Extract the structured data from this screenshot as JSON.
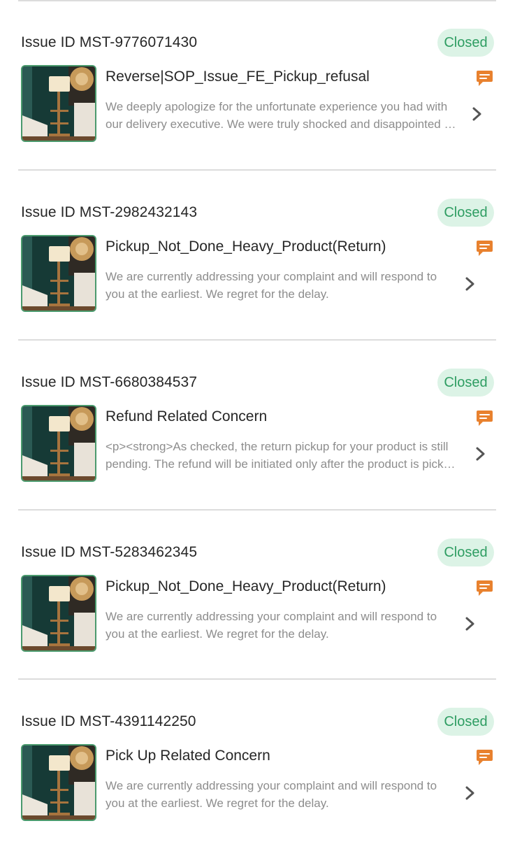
{
  "issues": [
    {
      "id_text": "Issue ID MST-9776071430",
      "status": "Closed",
      "title": "Reverse|SOP_Issue_FE_Pickup_refusal",
      "description": "We deeply apologize for the unfortunate experience you had with our delivery executive. We were truly shocked and disappointed to hear about this."
    },
    {
      "id_text": "Issue ID MST-2982432143",
      "status": "Closed",
      "title": "Pickup_Not_Done_Heavy_Product(Return)",
      "description": "We are currently addressing your complaint and will respond to you at the earliest. We regret for the delay."
    },
    {
      "id_text": "Issue ID MST-6680384537",
      "status": "Closed",
      "title": "Refund Related Concern",
      "description": "<p><strong>As checked, the return pickup for your product is still pending. The refund will be initiated only after the product is picked up."
    },
    {
      "id_text": "Issue ID MST-5283462345",
      "status": "Closed",
      "title": "Pickup_Not_Done_Heavy_Product(Return)",
      "description": "We are currently addressing your complaint and will respond to you at the earliest. We regret for the delay."
    },
    {
      "id_text": "Issue ID MST-4391142250",
      "status": "Closed",
      "title": "Pick Up Related Concern",
      "description": "We are currently addressing your complaint and will respond to you at the earliest. We regret for the delay."
    }
  ],
  "icons": {
    "thumbnail": "floor-lamp-product-image",
    "chat": "chat-bubble-icon",
    "chevron": "chevron-right-icon"
  },
  "colors": {
    "status_bg": "#dcf3e6",
    "status_text": "#2e9d62",
    "chat_icon": "#e8812e",
    "thumb_border": "#4a9a6d",
    "chevron": "#555555"
  }
}
